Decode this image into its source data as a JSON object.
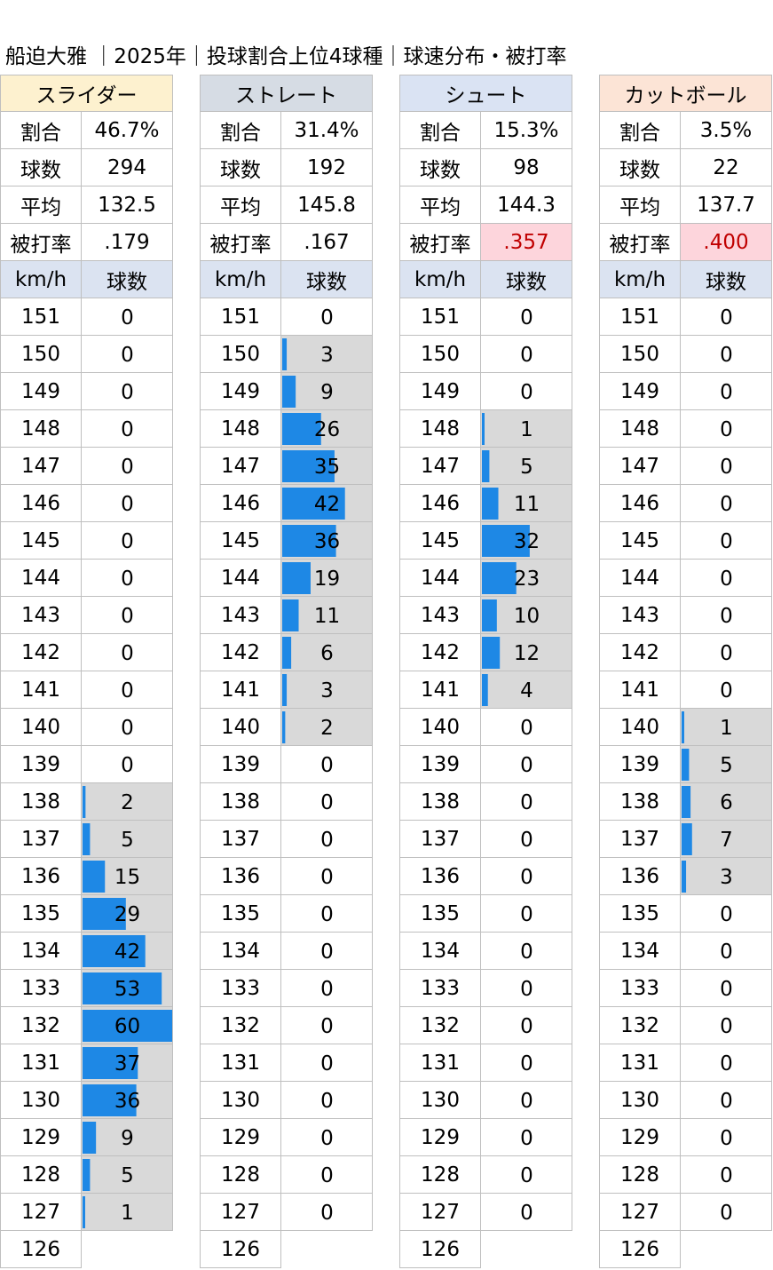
{
  "title": "船迫大雅 ｜2025年｜投球割合上位4球種｜球速分布・被打率",
  "labels": {
    "ratio": "割合",
    "count": "球数",
    "avg": "平均",
    "ba": "被打率",
    "kmh": "km/h",
    "count_col": "球数"
  },
  "colors": {
    "bar": "#1e88e5",
    "bar_bg": "#d9d9d9",
    "sub_header": "#dbe3f1",
    "highlight_bg": "#fdd5dc",
    "highlight_text": "#c00000"
  },
  "pitches": [
    {
      "name": "スライダー",
      "header_color": "#fdf1cf",
      "ratio": "46.7%",
      "count": "294",
      "avg": "132.5",
      "ba": ".179",
      "ba_highlight": false
    },
    {
      "name": "ストレート",
      "header_color": "#d6dce4",
      "ratio": "31.4%",
      "count": "192",
      "avg": "145.8",
      "ba": ".167",
      "ba_highlight": false
    },
    {
      "name": "シュート",
      "header_color": "#dae3f3",
      "ratio": "15.3%",
      "count": "98",
      "avg": "144.3",
      "ba": ".357",
      "ba_highlight": true
    },
    {
      "name": "カットボール",
      "header_color": "#fce4d6",
      "ratio": "3.5%",
      "count": "22",
      "avg": "137.7",
      "ba": ".400",
      "ba_highlight": true
    }
  ],
  "chart_data": {
    "type": "table",
    "title": "船迫大雅 ｜2025年｜投球割合上位4球種｜球速分布・被打率",
    "bar_max": 60,
    "speeds": [
      151,
      150,
      149,
      148,
      147,
      146,
      145,
      144,
      143,
      142,
      141,
      140,
      139,
      138,
      137,
      136,
      135,
      134,
      133,
      132,
      131,
      130,
      129,
      128,
      127,
      126
    ],
    "series": [
      {
        "name": "スライダー",
        "values": [
          0,
          0,
          0,
          0,
          0,
          0,
          0,
          0,
          0,
          0,
          0,
          0,
          0,
          2,
          5,
          15,
          29,
          42,
          53,
          60,
          37,
          36,
          9,
          5,
          1,
          0
        ],
        "range": [
          127,
          138
        ]
      },
      {
        "name": "ストレート",
        "values": [
          0,
          3,
          9,
          26,
          35,
          42,
          36,
          19,
          11,
          6,
          3,
          2,
          0,
          0,
          0,
          0,
          0,
          0,
          0,
          0,
          0,
          0,
          0,
          0,
          0,
          0
        ],
        "range": [
          140,
          150
        ]
      },
      {
        "name": "シュート",
        "values": [
          0,
          0,
          0,
          1,
          5,
          11,
          32,
          23,
          10,
          12,
          4,
          0,
          0,
          0,
          0,
          0,
          0,
          0,
          0,
          0,
          0,
          0,
          0,
          0,
          0,
          0
        ],
        "range": [
          141,
          148
        ]
      },
      {
        "name": "カットボール",
        "values": [
          0,
          0,
          0,
          0,
          0,
          0,
          0,
          0,
          0,
          0,
          0,
          1,
          5,
          6,
          7,
          3,
          0,
          0,
          0,
          0,
          0,
          0,
          0,
          0,
          0,
          0
        ],
        "range": [
          136,
          140
        ]
      }
    ]
  }
}
